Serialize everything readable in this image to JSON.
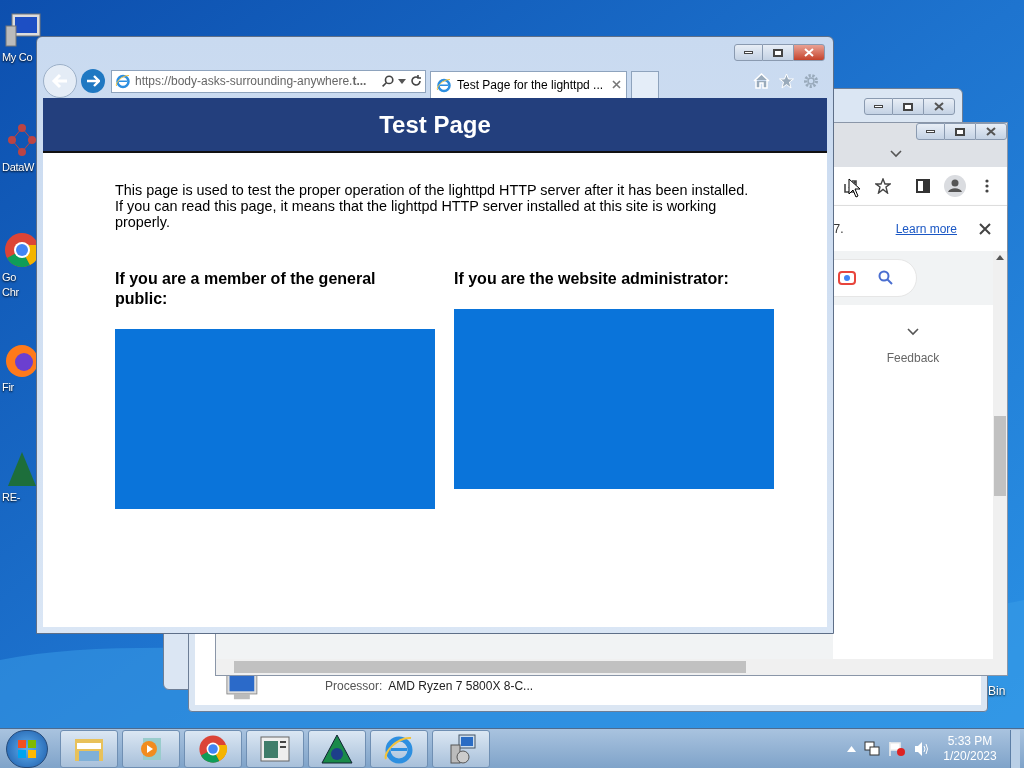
{
  "desktop_icons": [
    {
      "kind": "computer",
      "lines": [
        "My Co"
      ]
    },
    {
      "kind": "network",
      "lines": [
        "DataW"
      ]
    },
    {
      "kind": "chrome",
      "lines": [
        "Go",
        "Chr"
      ]
    },
    {
      "kind": "firefox",
      "lines": [
        "Fir"
      ]
    },
    {
      "kind": "tree",
      "lines": [
        "RE-"
      ]
    }
  ],
  "desktop_label": "Bin",
  "system_window": {
    "rows": [
      {
        "label": "Processor:",
        "value": "AMD Ryzen 7 5800X 8-C..."
      }
    ]
  },
  "chrome_window": {
    "infobar": {
      "text": "7.",
      "link": "Learn more"
    },
    "side_link": "Feedback"
  },
  "ie_window": {
    "address": "https://body-asks-surrounding-anywhere.**t...**",
    "tabs": [
      {
        "title": "Test Page for the lighttpd ...",
        "selected": true
      }
    ],
    "page": {
      "title": "Test Page",
      "intro": "This page is used to test the proper operation of the lighttpd HTTP server after it has been installed. If you can read this page, it means that the lighttpd HTTP server installed at this site is working properly.",
      "columns": [
        {
          "heading": "If you are a member of the general public:"
        },
        {
          "heading": "If you are the website administrator:"
        }
      ]
    }
  },
  "taskbar": {
    "apps": [
      {
        "kind": "explorer"
      },
      {
        "kind": "media"
      },
      {
        "kind": "chrome"
      },
      {
        "kind": "window"
      },
      {
        "kind": "triangle"
      },
      {
        "kind": "ie"
      },
      {
        "kind": "setup"
      }
    ],
    "clock": {
      "time": "5:33 PM",
      "date": "1/20/2023"
    }
  }
}
